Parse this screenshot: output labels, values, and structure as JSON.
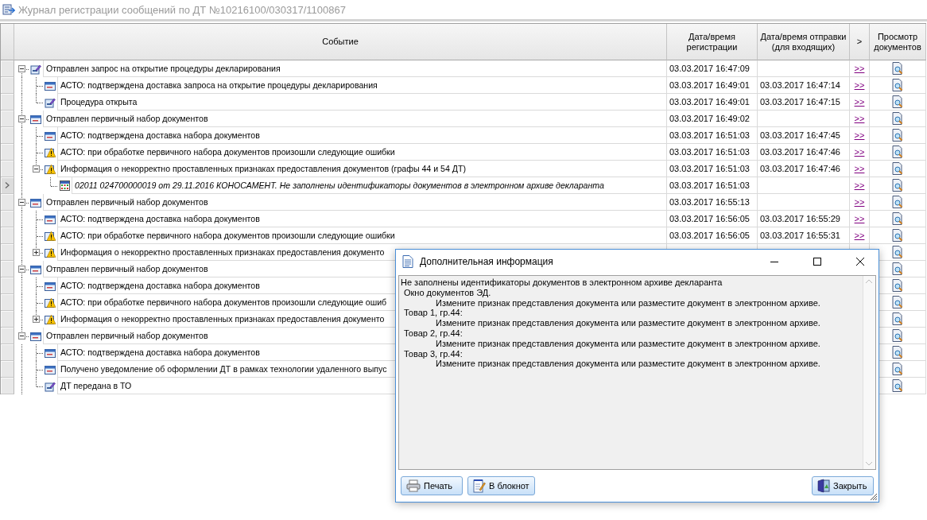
{
  "window": {
    "title": "Журнал регистрации сообщений по ДТ №10216100/030317/1100867"
  },
  "table": {
    "columns": [
      "Событие",
      "Дата/время регистрации",
      "Дата/время отправки (для входящих)",
      ">",
      "Просмотр документов"
    ],
    "rows": [
      {
        "text": "Отправлен запрос на открытие процедуры декларирования",
        "kind": "sent",
        "expanded": true,
        "selected": false,
        "registered": "03.03.2017 16:47:09",
        "link": ">>",
        "children": [
          {
            "text": "АСТО: подтверждена доставка запроса на открытие процедуры декларирования",
            "kind": "message",
            "selected": false,
            "registered": "03.03.2017 16:49:01",
            "sent": "03.03.2017 16:47:14",
            "link": ">>"
          },
          {
            "text": "Процедура открыта",
            "kind": "sent",
            "selected": false,
            "registered": "03.03.2017 16:49:01",
            "sent": "03.03.2017 16:47:15",
            "link": ">>"
          }
        ]
      },
      {
        "text": "Отправлен первичный набор документов",
        "kind": "message",
        "expanded": true,
        "selected": false,
        "registered": "03.03.2017 16:49:02",
        "link": ">>",
        "children": [
          {
            "text": "АСТО: подтверждена доставка набора документов",
            "kind": "message",
            "selected": false,
            "registered": "03.03.2017 16:51:03",
            "sent": "03.03.2017 16:47:45",
            "link": ">>"
          },
          {
            "text": "АСТО: при обработке первичного набора документов произошли следующие ошибки",
            "kind": "warning",
            "selected": false,
            "registered": "03.03.2017 16:51:03",
            "sent": "03.03.2017 16:47:46",
            "link": ">>"
          },
          {
            "text": "Информация о некорректно проставленных признаках предоставления документов (графы 44 и 54 ДТ)",
            "kind": "warning",
            "expanded": true,
            "selected": false,
            "registered": "03.03.2017 16:51:03",
            "sent": "03.03.2017 16:47:46",
            "link": ">>",
            "children": [
              {
                "text": "02011 024700000019 от 29.11.2016 КОНОСАМЕНТ. Не заполнены идентификаторы документов в электронном архиве декларанта",
                "kind": "table",
                "selected": true,
                "registered": "03.03.2017 16:51:03",
                "link": ">>"
              }
            ]
          }
        ]
      },
      {
        "text": "Отправлен первичный набор документов",
        "kind": "message",
        "expanded": true,
        "selected": false,
        "registered": "03.03.2017 16:55:13",
        "link": ">>",
        "children": [
          {
            "text": "АСТО: подтверждена доставка набора документов",
            "kind": "message",
            "selected": false,
            "registered": "03.03.2017 16:56:05",
            "sent": "03.03.2017 16:55:29",
            "link": ">>"
          },
          {
            "text": "АСТО: при обработке первичного набора документов произошли следующие ошибки",
            "kind": "warning",
            "selected": false,
            "registered": "03.03.2017 16:56:05",
            "sent": "03.03.2017 16:55:31",
            "link": ">>"
          },
          {
            "text": "Информация о некорректно проставленных признаках предоставления документо",
            "kind": "warning",
            "expanded": false,
            "selected": false
          }
        ]
      },
      {
        "text": "Отправлен первичный набор документов",
        "kind": "message",
        "expanded": true,
        "selected": false,
        "children": [
          {
            "text": "АСТО: подтверждена доставка набора документов",
            "kind": "message",
            "selected": false
          },
          {
            "text": "АСТО: при обработке первичного набора документов произошли следующие ошиб",
            "kind": "warning",
            "selected": false
          },
          {
            "text": "Информация о некорректно проставленных признаках предоставления документо",
            "kind": "warning",
            "expanded": false,
            "selected": false
          }
        ]
      },
      {
        "text": "Отправлен первичный набор документов",
        "kind": "message",
        "expanded": true,
        "selected": false,
        "children": [
          {
            "text": "АСТО: подтверждена доставка набора документов",
            "kind": "message",
            "selected": false
          },
          {
            "text": "Получено уведомление об оформлении ДТ в рамках технологии удаленного выпус",
            "kind": "message",
            "selected": false
          },
          {
            "text": "ДТ передана в ТО",
            "kind": "sent",
            "selected": false
          }
        ]
      }
    ]
  },
  "dialog": {
    "title": "Дополнительная информация",
    "lines": [
      {
        "kind": "title",
        "text": "Не заполнены идентификаторы документов в электронном архиве декларанта"
      },
      {
        "kind": "label",
        "text": "Окно документов ЭД."
      },
      {
        "kind": "detail",
        "text": "Измените признак представления документа или разместите документ в электронном архиве."
      },
      {
        "kind": "label",
        "text": "Товар 1, гр.44:"
      },
      {
        "kind": "detail",
        "text": "Измените признак представления документа или разместите документ в электронном архиве."
      },
      {
        "kind": "label",
        "text": "Товар 2, гр.44:"
      },
      {
        "kind": "detail",
        "text": "Измените признак представления документа или разместите документ в электронном архиве."
      },
      {
        "kind": "label",
        "text": "Товар 3, гр.44:"
      },
      {
        "kind": "detail",
        "text": "Измените признак представления документа или разместите документ в электронном архиве."
      }
    ],
    "buttons": [
      {
        "kind": "print",
        "label": "Печать"
      },
      {
        "kind": "notepad",
        "label": "В блокнот"
      },
      {
        "kind": "close",
        "label": "Закрыть"
      }
    ]
  }
}
